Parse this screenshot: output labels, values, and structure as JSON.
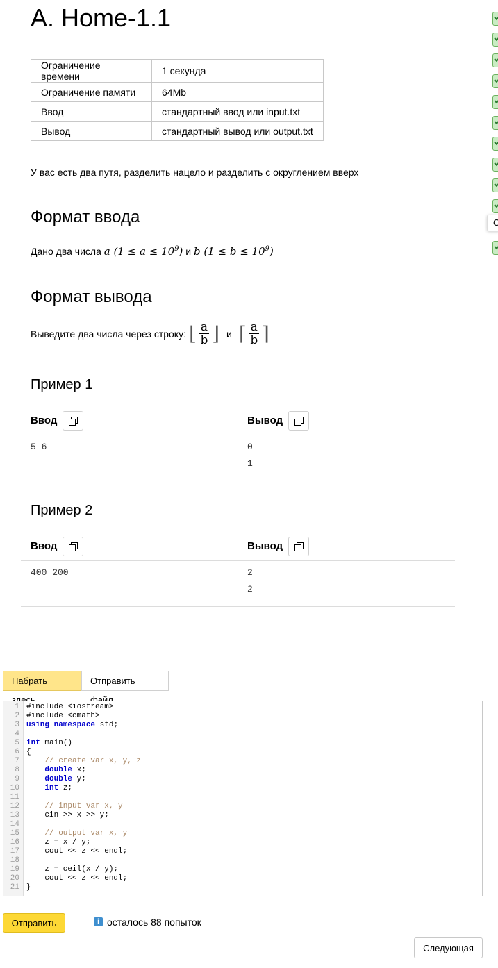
{
  "problem": {
    "title": "A. Home-1.1",
    "limits": [
      {
        "key": "Ограничение времени",
        "value": "1 секунда"
      },
      {
        "key": "Ограничение памяти",
        "value": "64Mb"
      },
      {
        "key": "Ввод",
        "value": "стандартный ввод или input.txt"
      },
      {
        "key": "Вывод",
        "value": "стандартный вывод или output.txt"
      }
    ],
    "legend": "У вас есть два путя, разделить нацело и разделить с округлением вверх",
    "input_heading": "Формат ввода",
    "input_text": {
      "prefix": "Дано два числа",
      "a_cond": "a (1 ≤ a ≤ 10",
      "exp": "9",
      "close": ")",
      "and": "и",
      "b_cond": "b (1 ≤ b ≤ 10"
    },
    "output_heading": "Формат вывода",
    "output_text": {
      "prefix": "Выведите два числа через строку:",
      "and": "и",
      "num": "a",
      "den": "b"
    },
    "examples": [
      {
        "title": "Пример 1",
        "in_label": "Ввод",
        "out_label": "Вывод",
        "input": "5 6",
        "output": [
          "0",
          "1"
        ]
      },
      {
        "title": "Пример 2",
        "in_label": "Ввод",
        "out_label": "Вывод",
        "input": "400 200",
        "output": [
          "2",
          "2"
        ]
      }
    ]
  },
  "submission": {
    "tabs": [
      "Набрать здесь",
      "Отправить файл"
    ],
    "active_tab": "Набрать здесь",
    "code_lines": [
      "#include <iostream>",
      "#include <cmath>",
      "using namespace std;",
      "",
      "int main()",
      "{",
      "    // create var x, y, z",
      "    double x;",
      "    double y;",
      "    int z;",
      "",
      "    // input var x, y",
      "    cin >> x >> y;",
      "",
      "    // output var x, y",
      "    z = x / y;",
      "    cout << z << endl;",
      "",
      "    z = ceil(x / y);",
      "    cout << z << endl;",
      "}"
    ],
    "submit_label": "Отправить",
    "attempts_icon": "i",
    "attempts_text": "осталось 88 попыток",
    "next_label": "Следующая"
  },
  "side_panel": {
    "tooltip_text": "O"
  },
  "colors": {
    "submit_bg": "#fdd835",
    "active_tab_bg": "#ffe58a",
    "badge_ok": "#c9ecc3",
    "keyword": "#0000cc",
    "comment": "#aa8866"
  }
}
